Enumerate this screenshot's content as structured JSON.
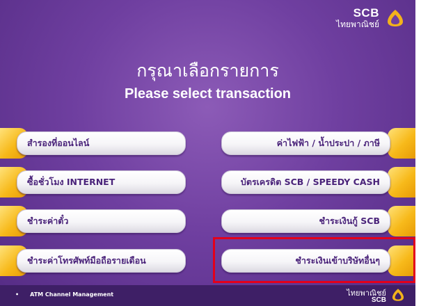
{
  "brand": {
    "name": "SCB",
    "thai_name": "ไทยพาณิชย์",
    "logo_icon": "scb-lotus-icon"
  },
  "title": {
    "thai": "กรุณาเลือกรายการ",
    "english": "Please select transaction"
  },
  "left_options": [
    {
      "label": "สำรองที่ออนไลน์"
    },
    {
      "label": "ซื้อชั่วโมง INTERNET"
    },
    {
      "label": "ชำระค่าตั๋ว"
    },
    {
      "label": "ชำระค่าโทรศัพท์มือถือรายเดือน"
    }
  ],
  "right_options": [
    {
      "label": "ค่าไฟฟ้า / น้ำประปา / ภาษี"
    },
    {
      "label": "บัตรเครดิต SCB / SPEEDY CASH"
    },
    {
      "label": "ชำระเงินกู้ SCB"
    },
    {
      "label": "ชำระเงินเข้าบริษัทอื่นๆ"
    }
  ],
  "footer": {
    "bullet": "•",
    "text": "ATM Channel Management",
    "brand_thai": "ไทยพาณิชย์",
    "brand_scb": "SCB"
  },
  "colors": {
    "background": "#6f3fa0",
    "button_text": "#4a237a",
    "tab": "#f7b91a",
    "highlight": "#e3001b",
    "footer": "#3e1f66"
  }
}
